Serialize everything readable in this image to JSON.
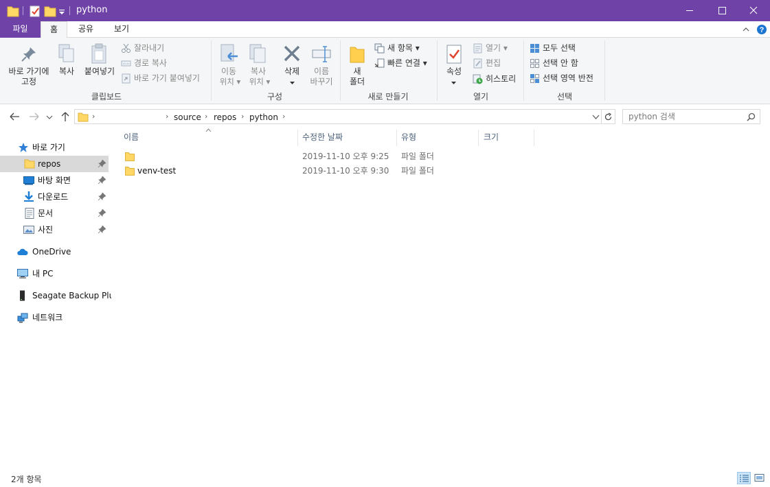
{
  "window": {
    "title": "python",
    "accent": "#6f42a8"
  },
  "ribbon_tabs": [
    {
      "label": "파일"
    },
    {
      "label": "홈"
    },
    {
      "label": "공유"
    },
    {
      "label": "보기"
    }
  ],
  "clipboard": {
    "pin_label_1": "바로 가기에",
    "pin_label_2": "고정",
    "copy_label": "복사",
    "paste_label": "붙여넣기",
    "cut_label": "잘라내기",
    "copy_path_label": "경로 복사",
    "paste_shortcut_label": "바로 가기 붙여넣기",
    "group_label": "클립보드"
  },
  "organize": {
    "move_label_1": "이동",
    "move_label_2": "위치 ▾",
    "copyto_label_1": "복사",
    "copyto_label_2": "위치 ▾",
    "delete_label": "삭제",
    "rename_label_1": "이름",
    "rename_label_2": "바꾸기",
    "group_label": "구성"
  },
  "new": {
    "new_folder_label_1": "새",
    "new_folder_label_2": "폴더",
    "new_item_label": "새 항목 ▾",
    "easy_access_label": "빠른 연결 ▾",
    "group_label": "새로 만들기"
  },
  "open": {
    "properties_label": "속성",
    "open_label": "열기 ▾",
    "edit_label": "편집",
    "history_label": "히스토리",
    "group_label": "열기"
  },
  "select": {
    "select_all_label": "모두 선택",
    "select_none_label": "선택 안 함",
    "invert_label": "선택 영역 반전",
    "group_label": "선택"
  },
  "address": {
    "crumbs": [
      "source",
      "repos",
      "python"
    ]
  },
  "search": {
    "placeholder": "python 검색"
  },
  "nav_pane": {
    "quick_access": "바로 가기",
    "items": [
      {
        "label": "repos"
      },
      {
        "label": "바탕 화면"
      },
      {
        "label": "다운로드"
      },
      {
        "label": "문서"
      },
      {
        "label": "사진"
      }
    ],
    "onedrive": "OneDrive",
    "this_pc": "내 PC",
    "seagate": "Seagate Backup Plus",
    "network": "네트워크"
  },
  "columns": {
    "name": "이름",
    "modified": "수정한 날짜",
    "type": "유형",
    "size": "크기"
  },
  "files": [
    {
      "name": "",
      "modified": "2019-11-10 오후 9:25",
      "type": "파일 폴더"
    },
    {
      "name": "venv-test",
      "modified": "2019-11-10 오후 9:30",
      "type": "파일 폴더"
    }
  ],
  "status": {
    "item_count": "2개 항목"
  }
}
